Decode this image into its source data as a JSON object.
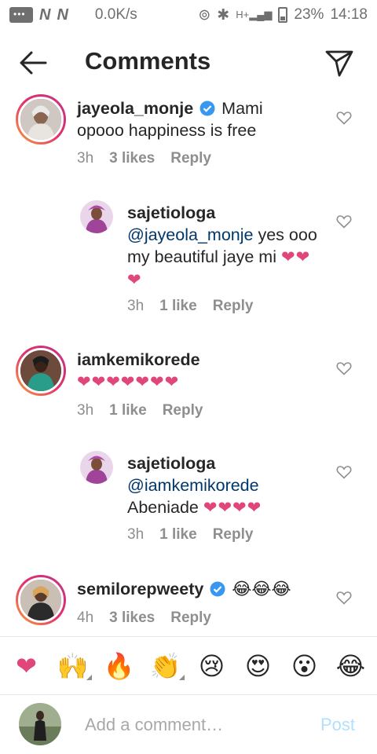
{
  "status_bar": {
    "carrier_icons": [
      "N",
      "N"
    ],
    "speed": "0.0K/s",
    "network": "H+",
    "battery": "23%",
    "time": "14:18"
  },
  "header": {
    "title": "Comments",
    "back_icon": "arrow-left-icon",
    "send_icon": "paper-plane-icon"
  },
  "comments": [
    {
      "username": "jayeola_monje",
      "verified": true,
      "text": "Mami opooo happiness is free",
      "time": "3h",
      "likes": "3 likes",
      "reply": "Reply"
    },
    {
      "username": "sajetiologa",
      "mention": "@jayeola_monje",
      "text": "yes ooo my beautiful jaye mi",
      "hearts": "❤❤❤",
      "time": "3h",
      "likes": "1 like",
      "reply": "Reply"
    },
    {
      "username": "iamkemikorede",
      "hearts": "❤❤❤❤❤❤❤",
      "time": "3h",
      "likes": "1 like",
      "reply": "Reply"
    },
    {
      "username": "sajetiologa",
      "mention": "@iamkemikorede",
      "text": "Abeniade",
      "hearts": "❤❤❤❤",
      "time": "3h",
      "likes": "1 like",
      "reply": "Reply"
    },
    {
      "username": "semilorepweety",
      "verified": true,
      "emojis": "😂😂😂",
      "time": "4h",
      "likes": "3 likes",
      "reply": "Reply"
    }
  ],
  "emoji_bar": [
    "❤",
    "🙌",
    "🔥",
    "👏",
    "😢",
    "😍",
    "😮",
    "😂"
  ],
  "composer": {
    "placeholder": "Add a comment…",
    "post_label": "Post"
  },
  "colors": {
    "heart": "#e0457b",
    "mention": "#00376b",
    "verified": "#3897f0",
    "post_disabled": "#b2dffc"
  }
}
